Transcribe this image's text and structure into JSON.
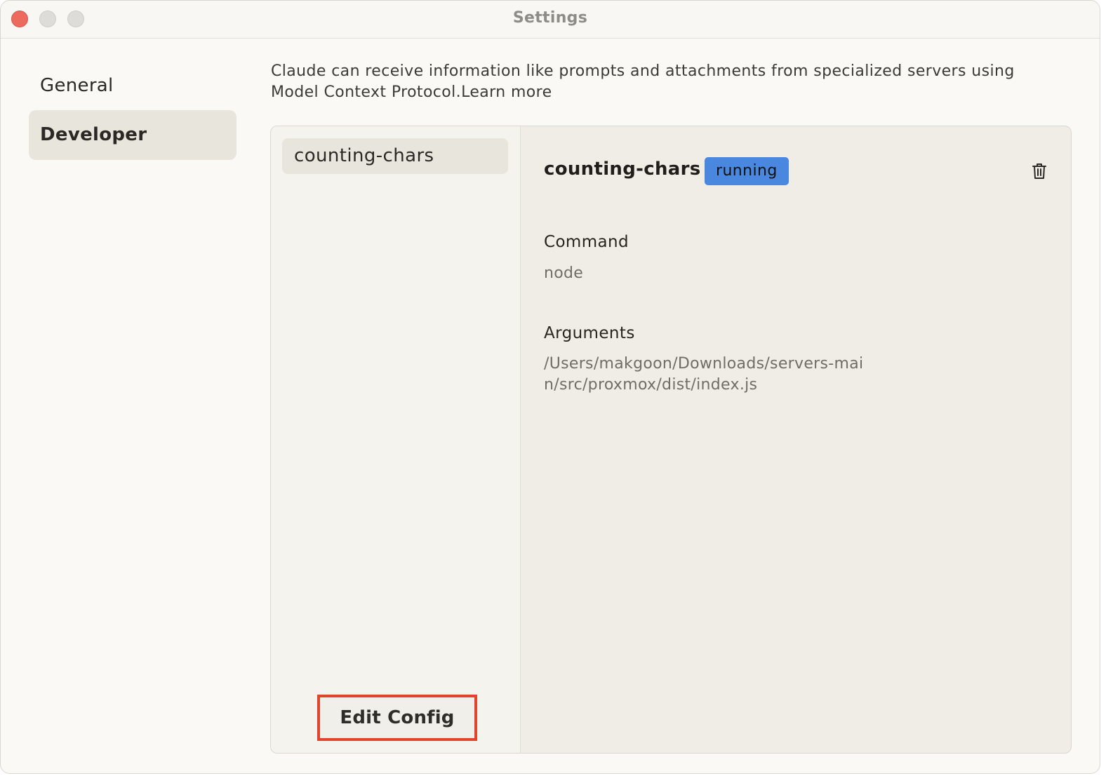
{
  "window": {
    "title": "Settings"
  },
  "sidebar": {
    "items": [
      {
        "label": "General",
        "active": false
      },
      {
        "label": "Developer",
        "active": true
      }
    ]
  },
  "intro": {
    "text": "Claude can receive information like prompts and attachments from specialized servers using Model Context Protocol.",
    "link": "Learn more"
  },
  "servers": {
    "items": [
      {
        "name": "counting-chars"
      }
    ],
    "edit_config_label": "Edit Config"
  },
  "detail": {
    "name": "counting-chars",
    "status": "running",
    "status_color": "#4a88e0",
    "delete_icon": "trash-icon",
    "command_label": "Command",
    "command_value": "node",
    "arguments_label": "Arguments",
    "arguments_value": "/Users/makgoon/Downloads/servers-main/src/proxmox/dist/index.js"
  },
  "colors": {
    "close": "#ed6a5e",
    "highlight": "#e0452c"
  }
}
